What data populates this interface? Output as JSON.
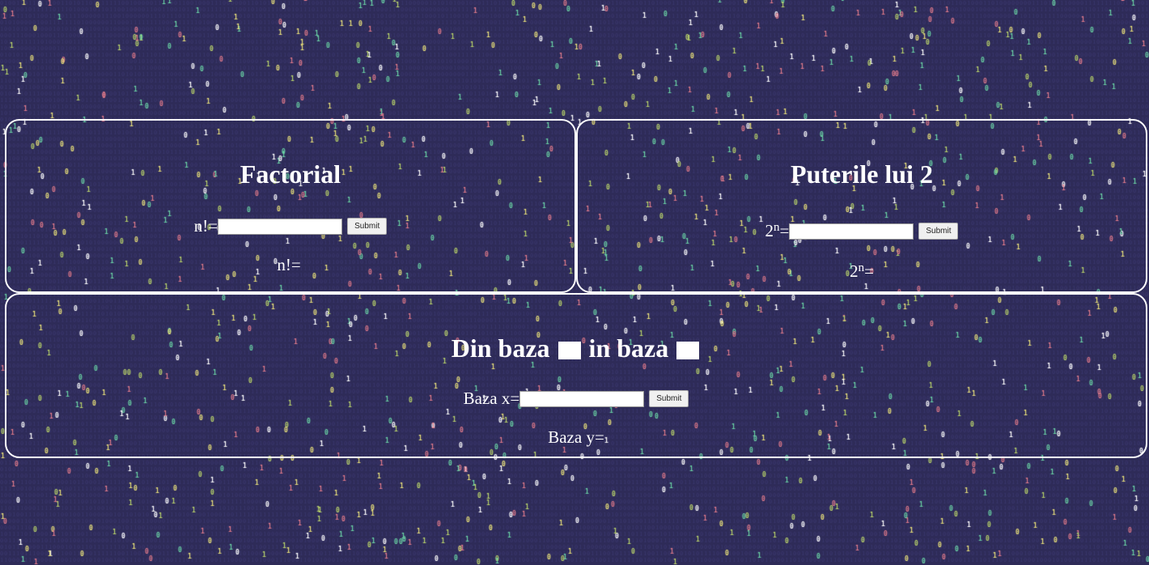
{
  "factorial": {
    "title": "Factorial",
    "input_label": "n!=",
    "input_value": "",
    "submit_label": "Submit",
    "result_label": "n!="
  },
  "powers": {
    "title": "Puterile lui 2",
    "base": "2",
    "exponent": "n",
    "input_suffix": "=",
    "input_value": "",
    "submit_label": "Submit",
    "result_suffix": "="
  },
  "base_conversion": {
    "title_part1": "Din baza",
    "title_part2": "in baza",
    "input_label": "Baza x=",
    "input_value": "",
    "submit_label": "Submit",
    "result_label": "Baza y="
  },
  "colors": {
    "background": "#2e2b58",
    "text": "#ffffff",
    "border": "#ffffff",
    "digit_colors": [
      "#e8e07a",
      "#ffffff",
      "#6ad3a5",
      "#e07a8a",
      "#b9d36a"
    ]
  }
}
